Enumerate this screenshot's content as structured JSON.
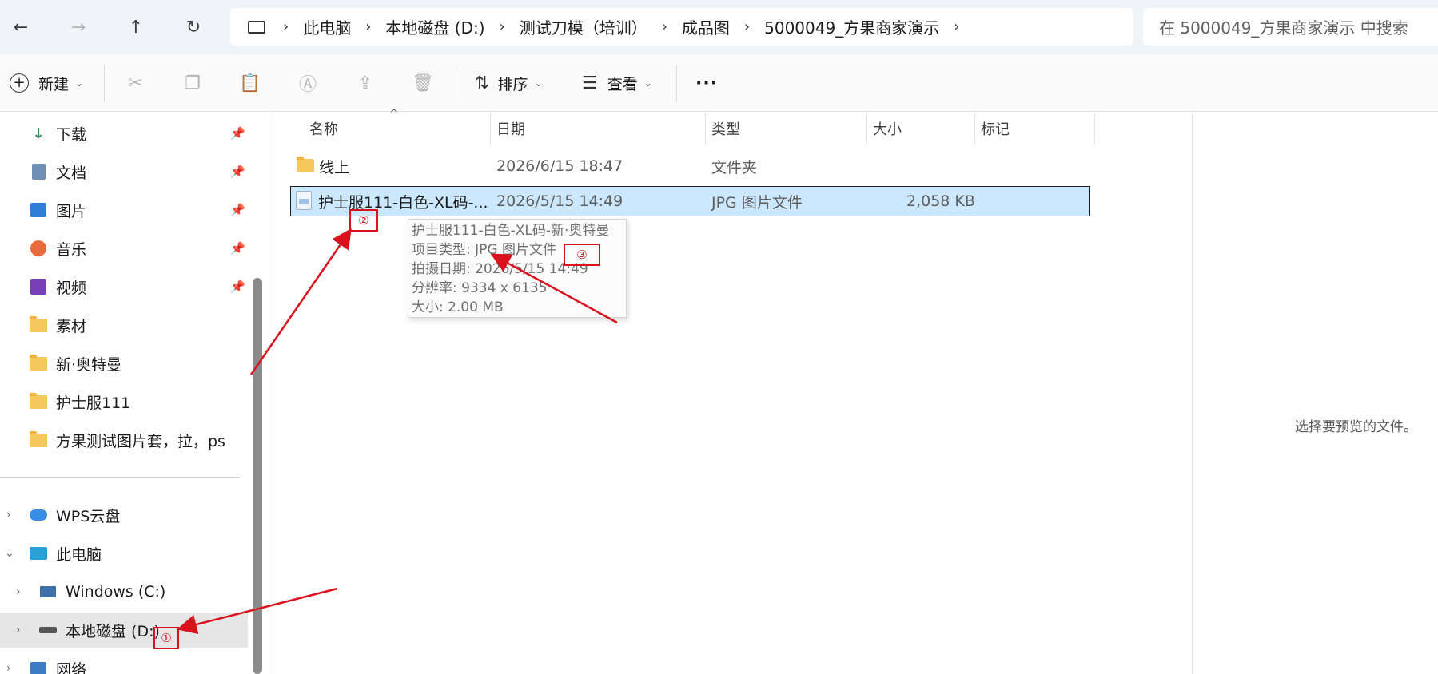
{
  "nav_buttons": {
    "back": "←",
    "forward": "→",
    "up": "↑",
    "refresh": "↻"
  },
  "address": {
    "crumbs": [
      "此电脑",
      "本地磁盘 (D:)",
      "测试刀模（培训）",
      "成品图",
      "5000049_方果商家演示"
    ]
  },
  "search": {
    "placeholder": "在 5000049_方果商家演示 中搜索"
  },
  "toolbar": {
    "new_label": "新建",
    "sort_label": "排序",
    "view_label": "查看",
    "more_label": "···"
  },
  "sidebar": {
    "quick": [
      {
        "label": "下载",
        "icon": "download-icon"
      },
      {
        "label": "文档",
        "icon": "document-icon"
      },
      {
        "label": "图片",
        "icon": "picture-icon"
      },
      {
        "label": "音乐",
        "icon": "music-icon"
      },
      {
        "label": "视频",
        "icon": "video-icon"
      },
      {
        "label": "素材",
        "icon": "folder-icon"
      },
      {
        "label": "新·奥特曼",
        "icon": "folder-icon"
      },
      {
        "label": "护士服111",
        "icon": "folder-icon"
      },
      {
        "label": "方果测试图片套，拉，ps",
        "icon": "folder-icon"
      }
    ],
    "tree": {
      "wps": "WPS云盘",
      "this_pc": "此电脑",
      "drive_c": "Windows (C:)",
      "drive_d": "本地磁盘 (D:)",
      "network": "网络"
    }
  },
  "columns": {
    "name": "名称",
    "date": "日期",
    "type": "类型",
    "size": "大小",
    "tag": "标记"
  },
  "files": [
    {
      "name": "线上",
      "date": "2026/6/15 18:47",
      "type": "文件夹",
      "size": ""
    },
    {
      "name": "护士服111-白色-XL码-...",
      "date": "2026/5/15 14:49",
      "type": "JPG 图片文件",
      "size": "2,058 KB"
    }
  ],
  "tooltip": {
    "title": "护士服111-白色-XL码-新·奥特曼",
    "type": "项目类型: JPG 图片文件",
    "date": "拍摄日期: 2026/5/15 14:49",
    "resolution": "分辨率: 9334 x 6135",
    "size": "大小: 2.00 MB"
  },
  "preview": {
    "empty_text": "选择要预览的文件。"
  },
  "annotations": {
    "one": "①",
    "two": "②",
    "three": "③"
  },
  "colors": {
    "accent": "#cce8ff",
    "annotation": "#d9121e",
    "folder": "#f6c75a"
  }
}
